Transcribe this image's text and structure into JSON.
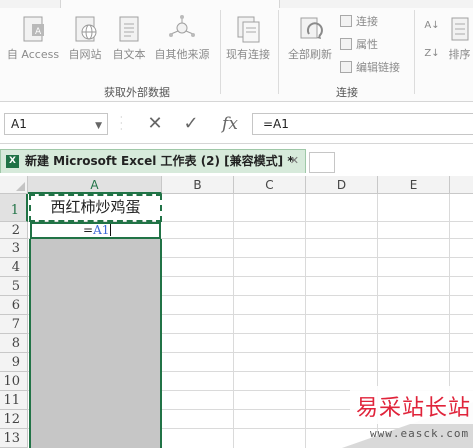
{
  "ribbon": {
    "buttons": [
      {
        "label": "自 Access",
        "icon": "access-db-icon"
      },
      {
        "label": "自网站",
        "icon": "web-globe-icon"
      },
      {
        "label": "自文本",
        "icon": "text-file-icon"
      },
      {
        "label": "自其他来源",
        "icon": "other-sources-icon"
      },
      {
        "label": "现有连接",
        "icon": "existing-connections-icon"
      },
      {
        "label": "全部刷新",
        "icon": "refresh-all-icon"
      }
    ],
    "small_buttons": [
      {
        "label": "连接",
        "icon": "connections-icon"
      },
      {
        "label": "属性",
        "icon": "properties-icon"
      },
      {
        "label": "编辑链接",
        "icon": "edit-links-icon"
      }
    ],
    "sort_labels": [
      "A↓",
      "Z↓"
    ],
    "sort_button_label": "排序",
    "group_labels": [
      "获取外部数据",
      "连接"
    ]
  },
  "formula_bar": {
    "name_box": "A1",
    "cancel_symbol": "✕",
    "enter_symbol": "✓",
    "fx_label": "fx",
    "formula": "=A1"
  },
  "workbook": {
    "tab_title": "新建 Microsoft Excel 工作表 (2)  [兼容模式] *",
    "close_symbol": "✕",
    "excel_badge": "X"
  },
  "sheet": {
    "columns": [
      "A",
      "B",
      "C",
      "D",
      "E"
    ],
    "rows": [
      "1",
      "2",
      "3",
      "4",
      "5",
      "6",
      "7",
      "8",
      "9",
      "10",
      "11",
      "12",
      "13"
    ],
    "selected_column": "A",
    "cells": {
      "A1": "西红柿炒鸡蛋",
      "A2_prefix": "=",
      "A2_ref": "A1"
    }
  },
  "watermark": {
    "text": "易采站长站",
    "url": "www.easck.com"
  },
  "colors": {
    "excel_green": "#217346",
    "selection_gray": "#c6c6c6",
    "watermark_red": "#e0233a",
    "ref_blue": "#3d6ad6"
  }
}
